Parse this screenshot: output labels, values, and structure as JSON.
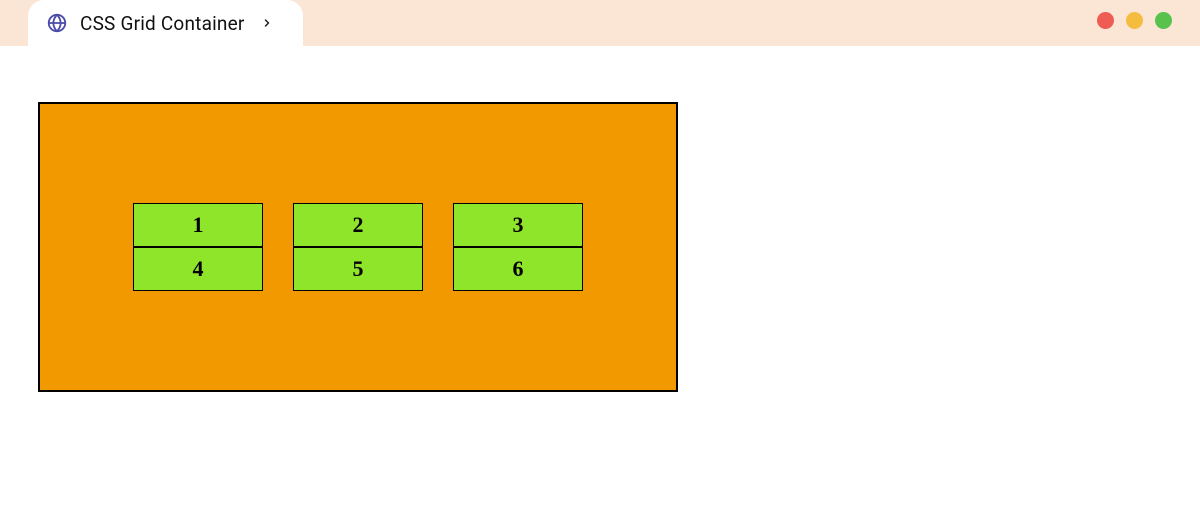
{
  "tab": {
    "title": "CSS Grid Container"
  },
  "window_controls": {
    "red": "#ee5c54",
    "yellow": "#f5bd40",
    "green": "#58c24c"
  },
  "grid": {
    "container_color": "#f29900",
    "cell_color": "#8fe52a",
    "cells": [
      "1",
      "2",
      "3",
      "4",
      "5",
      "6"
    ]
  }
}
